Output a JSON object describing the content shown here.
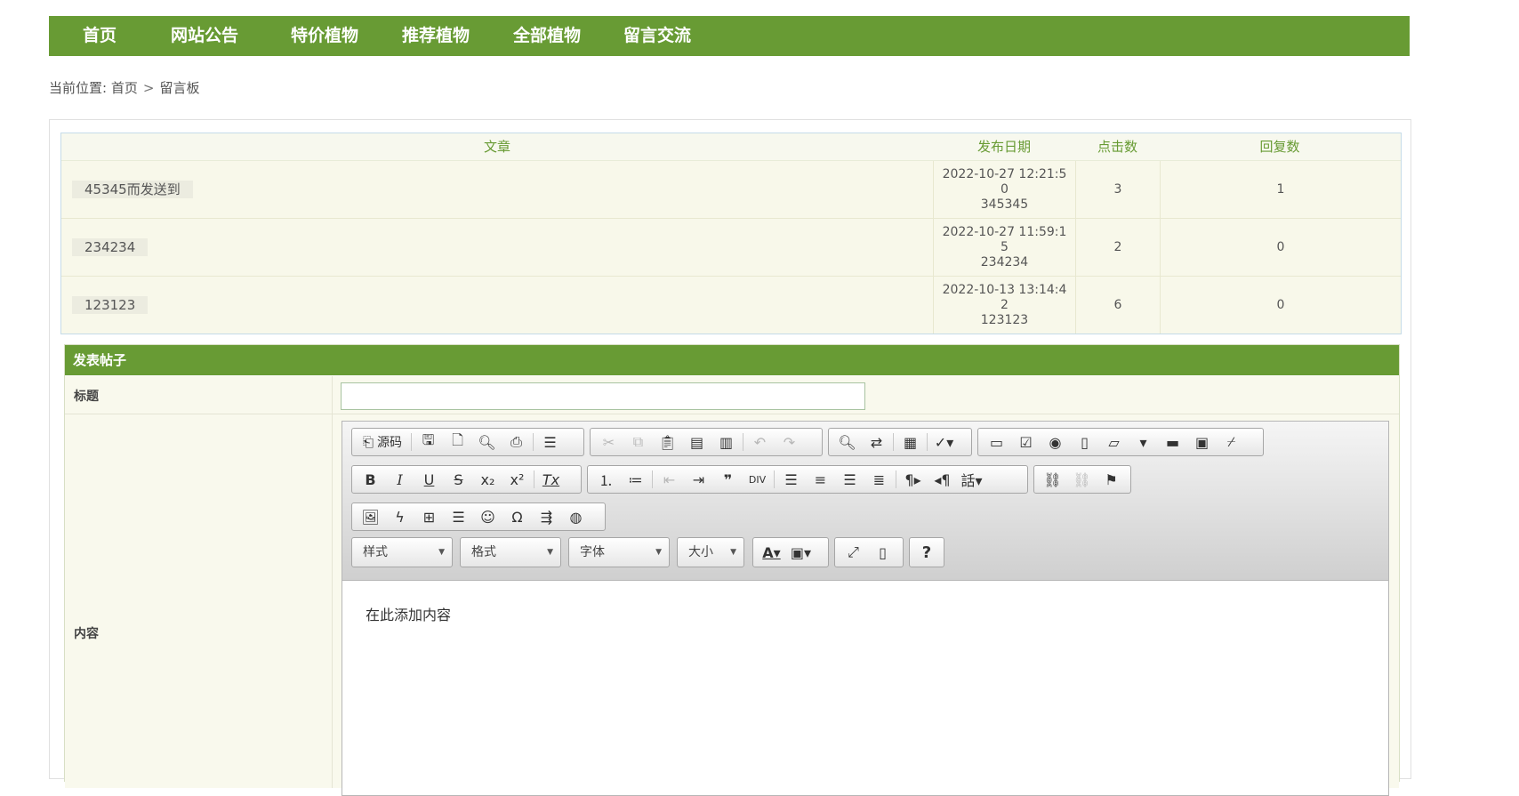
{
  "nav": {
    "items": [
      "首页",
      "网站公告",
      "特价植物",
      "推荐植物",
      "全部植物",
      "留言交流"
    ]
  },
  "breadcrumb": {
    "prefix": "当前位置:",
    "home": "首页",
    "separator": ">",
    "current": "留言板"
  },
  "table": {
    "headers": [
      "文章",
      "发布日期",
      "点击数",
      "回复数"
    ],
    "rows": [
      {
        "title": "45345而发送到",
        "date": [
          "2022-10-27 12:21:5",
          "0",
          "345345"
        ],
        "clicks": "3",
        "replies": "1"
      },
      {
        "title": "234234",
        "date": [
          "2022-10-27 11:59:1",
          "5",
          "234234"
        ],
        "clicks": "2",
        "replies": "0"
      },
      {
        "title": "123123",
        "date": [
          "2022-10-13 13:14:4",
          "2",
          "123123"
        ],
        "clicks": "6",
        "replies": "0"
      }
    ]
  },
  "post_form": {
    "header": "发表帖子",
    "title_label": "标题",
    "title_value": "",
    "content_label": "内容",
    "editor": {
      "source_label": "源码",
      "style_combo": "样式",
      "format_combo": "格式",
      "font_combo": "字体",
      "size_combo": "大小",
      "content": "在此添加内容"
    }
  },
  "colors": {
    "nav_bg": "#689b34",
    "header_text": "#689b34",
    "row_bg": "#f8f8ea"
  }
}
